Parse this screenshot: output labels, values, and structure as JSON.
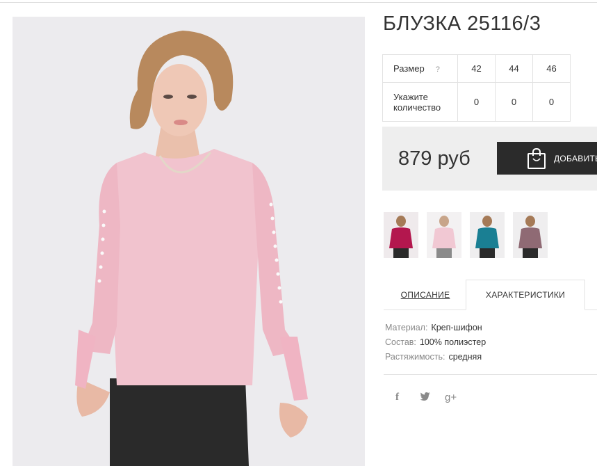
{
  "product": {
    "title": "БЛУЗКА 25116/3"
  },
  "size_table": {
    "size_label": "Размер",
    "help_icon": "?",
    "sizes": [
      "42",
      "44",
      "46"
    ],
    "qty_label": "Укажите количество",
    "quantities": [
      "0",
      "0",
      "0"
    ]
  },
  "price": {
    "value": "879 руб",
    "add_button": "ДОБАВИТЬ"
  },
  "thumbnails": [
    {
      "color": "#b3174e",
      "icon": "thumb-burgundy"
    },
    {
      "color": "#f1c8d3",
      "icon": "thumb-pink"
    },
    {
      "color": "#1a7f93",
      "icon": "thumb-teal"
    },
    {
      "color": "#8f6a74",
      "icon": "thumb-mauve"
    }
  ],
  "tabs": {
    "description": "ОПИСАНИЕ",
    "characteristics": "ХАРАКТЕРИСТИКИ"
  },
  "specs": [
    {
      "key": "Материал:",
      "value": "Креп-шифон"
    },
    {
      "key": "Состав:",
      "value": "100% полиэстер"
    },
    {
      "key": "Растяжимость:",
      "value": "средняя"
    }
  ],
  "social": {
    "facebook": "f",
    "twitter": "t",
    "googleplus": "g+"
  },
  "colors": {
    "blouse": "#f1c3ce",
    "button": "#2b2b2b",
    "price_bg": "#eeeeee"
  }
}
